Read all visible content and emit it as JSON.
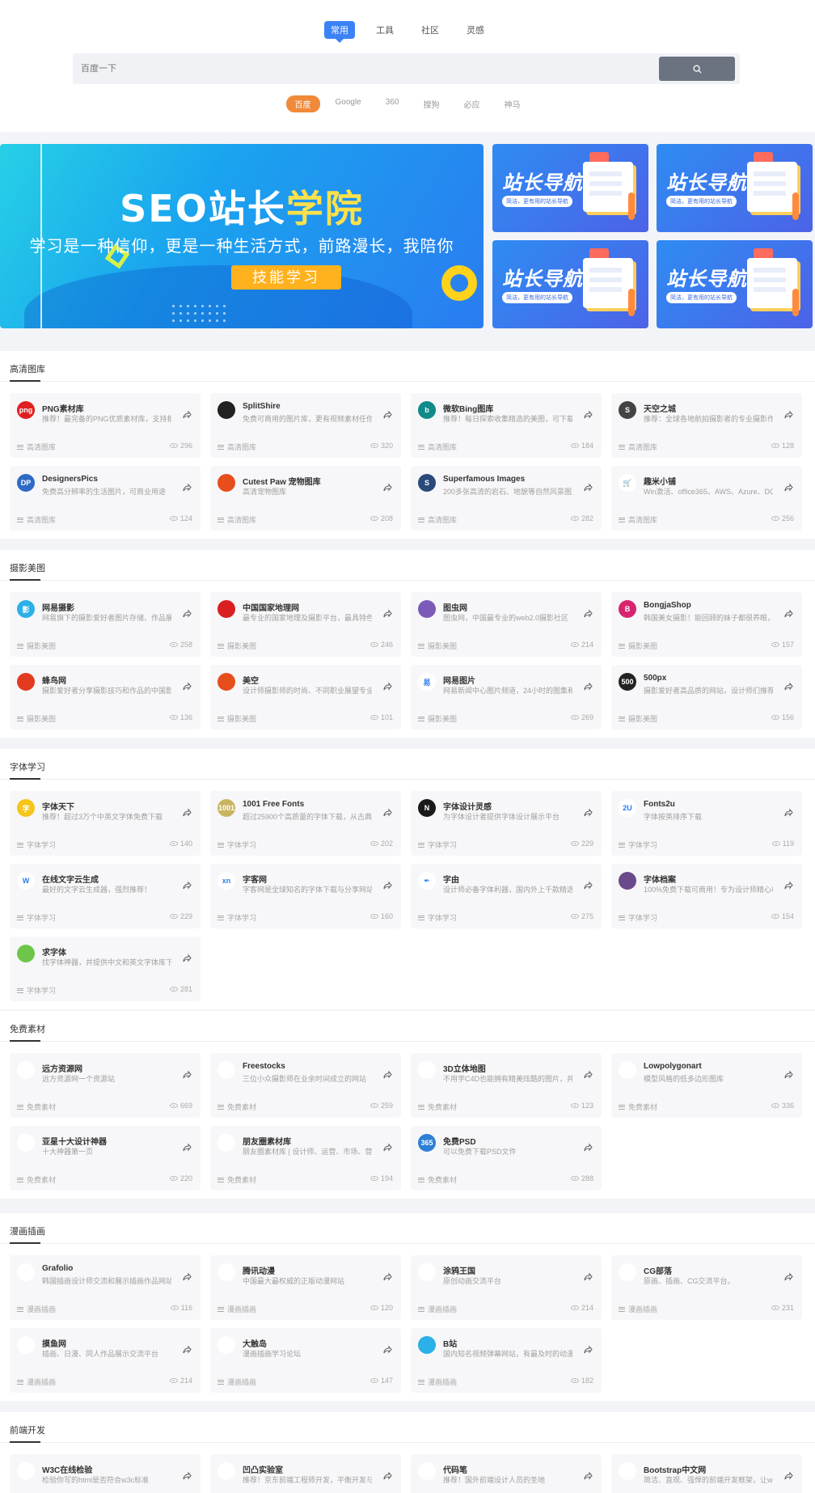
{
  "search": {
    "tabs": [
      "常用",
      "工具",
      "社区",
      "灵感"
    ],
    "active_tab": 0,
    "placeholder": "百度一下",
    "engines": [
      "百度",
      "Google",
      "360",
      "搜狗",
      "必应",
      "神马"
    ],
    "active_engine": 0
  },
  "banners": {
    "main": {
      "title_a": "SEO站长",
      "title_b": "学院",
      "subtitle": "学习是一种信仰，更是一种生活方式，前路漫长，我陪你",
      "button": "技能学习"
    },
    "small": [
      {
        "title": "站长导航",
        "pill": "简洁，更有用的站长导航"
      },
      {
        "title": "站长导航",
        "pill": "简洁，更有用的站长导航"
      },
      {
        "title": "站长导航",
        "pill": "简洁，更有用的站长导航"
      },
      {
        "title": "站长导航",
        "pill": "简洁，更有用的站长导航"
      }
    ]
  },
  "sections": [
    {
      "title": "高清图库",
      "cards": [
        {
          "name": "PNG素材库",
          "desc": "推荐！最完备的PNG优质素材库，支持批量",
          "tag": "高清图库",
          "views": "296",
          "logo": "png",
          "color": "#e02020"
        },
        {
          "name": "SplitShire",
          "desc": "免费可商用的图片库，更有视频素材任你选",
          "tag": "高清图库",
          "views": "320",
          "logo": "",
          "color": "#222"
        },
        {
          "name": "微软Bing图库",
          "desc": "推荐！每日探索收集精选的美图，可下载",
          "tag": "高清图库",
          "views": "184",
          "logo": "b",
          "color": "#108a8a"
        },
        {
          "name": "天空之城",
          "desc": "推荐：全球各地航拍摄影者的专业摄影作品",
          "tag": "高清图库",
          "views": "128",
          "logo": "S",
          "color": "#444"
        },
        {
          "name": "DesignersPics",
          "desc": "免费高分辨率的生活图片，可商业用途",
          "tag": "高清图库",
          "views": "124",
          "logo": "DP",
          "color": "#2f6bc4"
        },
        {
          "name": "Cutest Paw 宠物图库",
          "desc": "高清宠物图库",
          "tag": "高清图库",
          "views": "208",
          "logo": "",
          "color": "#e84d1c"
        },
        {
          "name": "Superfamous Images",
          "desc": "200多张高清的岩石、地貌等自然风景图片",
          "tag": "高清图库",
          "views": "282",
          "logo": "S",
          "color": "#2a4a7a"
        },
        {
          "name": "趣米小铺",
          "desc": "Win激活、office365、AWS、Azure、DO",
          "tag": "高清图库",
          "views": "256",
          "logo": "🛒",
          "color": "#ffffff"
        }
      ]
    },
    {
      "title": "摄影美图",
      "cards": [
        {
          "name": "网易摄影",
          "desc": "网易旗下的摄影爱好者图片存储、作品展示",
          "tag": "摄影美图",
          "views": "258",
          "logo": "影",
          "color": "#2bb0e8"
        },
        {
          "name": "中国国家地理网",
          "desc": "最专业的国家地理及摄影平台，最具特色的",
          "tag": "摄影美图",
          "views": "246",
          "logo": "",
          "color": "#d91f1f"
        },
        {
          "name": "图虫网",
          "desc": "图虫网，中国最专业的web2.0摄影社区",
          "tag": "摄影美图",
          "views": "214",
          "logo": "",
          "color": "#7c5bb8"
        },
        {
          "name": "BongjaShop",
          "desc": "韩国美女摄影！能回顾的妹子都很养眼，不",
          "tag": "摄影美图",
          "views": "157",
          "logo": "B",
          "color": "#d8246f"
        },
        {
          "name": "蜂鸟网",
          "desc": "摄影爱好者分享摄影技巧和作品的中国影像",
          "tag": "摄影美图",
          "views": "136",
          "logo": "",
          "color": "#e23a1e"
        },
        {
          "name": "美空",
          "desc": "设计师摄影师的时尚、不同职业展望专业摄影",
          "tag": "摄影美图",
          "views": "101",
          "logo": "",
          "color": "#e84d1c"
        },
        {
          "name": "网易图片",
          "desc": "网易新闻中心图片频道，24小时的图集和大",
          "tag": "摄影美图",
          "views": "269",
          "logo": "易",
          "color": "#ffffff"
        },
        {
          "name": "500px",
          "desc": "摄影爱好者高品质的网站，设计师们推荐套",
          "tag": "摄影美图",
          "views": "156",
          "logo": "500",
          "color": "#222"
        }
      ]
    },
    {
      "title": "字体学习",
      "cards": [
        {
          "name": "字体天下",
          "desc": "推荐！超过3万个中英文字体免费下载",
          "tag": "字体学习",
          "views": "140",
          "logo": "字",
          "color": "#f5c518"
        },
        {
          "name": "1001 Free Fonts",
          "desc": "超过25900个高质量的字体下载，从古典的",
          "tag": "字体学习",
          "views": "202",
          "logo": "1001",
          "color": "#c8b560"
        },
        {
          "name": "字体设计灵感",
          "desc": "为字体设计者提供字体设计展示平台",
          "tag": "字体学习",
          "views": "229",
          "logo": "N",
          "color": "#1a1a1a"
        },
        {
          "name": "Fonts2u",
          "desc": "字体按英排序下载",
          "tag": "字体学习",
          "views": "119",
          "logo": "2U",
          "color": "#ffffff"
        },
        {
          "name": "在线文字云生成",
          "desc": "最好的文字云生成器，强烈推荐！",
          "tag": "字体学习",
          "views": "229",
          "logo": "W",
          "color": "#ffffff"
        },
        {
          "name": "字客网",
          "desc": "字客网是全球知名的字体下载与分享网站",
          "tag": "字体学习",
          "views": "160",
          "logo": "xn",
          "color": "#ffffff"
        },
        {
          "name": "字由",
          "desc": "设计师必备字体利器，国内外上千款精选字",
          "tag": "字体学习",
          "views": "275",
          "logo": "✒",
          "color": "#ffffff"
        },
        {
          "name": "字体档案",
          "desc": "100%免费下载可商用！专为设计师精心收集",
          "tag": "字体学习",
          "views": "154",
          "logo": "",
          "color": "#6a4a8a"
        },
        {
          "name": "求字体",
          "desc": "找字体神器，并提供中文和英文字体库下载",
          "tag": "字体学习",
          "views": "281",
          "logo": "",
          "color": "#6dc64a"
        }
      ]
    },
    {
      "title": "免费素材",
      "cards": [
        {
          "name": "远方资源网",
          "desc": "远方资源网一个资源站",
          "tag": "免费素材",
          "views": "669",
          "logo": "",
          "color": "#ffffff"
        },
        {
          "name": "Freestocks",
          "desc": "三位小众摄影师在业余时间成立的网站",
          "tag": "免费素材",
          "views": "259",
          "logo": "",
          "color": "#ffffff"
        },
        {
          "name": "3D立体地图",
          "desc": "不用学C4D也能拥有精美炫酷的图片，并",
          "tag": "免费素材",
          "views": "123",
          "logo": "",
          "color": "#ffffff"
        },
        {
          "name": "Lowpolygonart",
          "desc": "模型风格的低多边形图库",
          "tag": "免费素材",
          "views": "336",
          "logo": "",
          "color": "#ffffff"
        },
        {
          "name": "亚星十大设计神器",
          "desc": "十大神器第一页",
          "tag": "免费素材",
          "views": "220",
          "logo": "",
          "color": "#ffffff"
        },
        {
          "name": "朋友圈素材库",
          "desc": "朋友圈素材库 | 设计师、运营、市场、营",
          "tag": "免费素材",
          "views": "194",
          "logo": "",
          "color": "#ffffff"
        },
        {
          "name": "免费PSD",
          "desc": "可以免费下载PSD文件",
          "tag": "免费素材",
          "views": "288",
          "logo": "365",
          "color": "#2e7fd6"
        }
      ]
    },
    {
      "title": "漫画插画",
      "cards": [
        {
          "name": "Grafolio",
          "desc": "韩国插画设计师交流和展示插画作品网站",
          "tag": "漫画插画",
          "views": "116",
          "logo": "",
          "color": "#ffffff"
        },
        {
          "name": "腾讯动漫",
          "desc": "中国最大最权威的正版动漫网站",
          "tag": "漫画插画",
          "views": "120",
          "logo": "",
          "color": "#ffffff"
        },
        {
          "name": "涂鸦王国",
          "desc": "原创动画交流平台",
          "tag": "漫画插画",
          "views": "214",
          "logo": "",
          "color": "#ffffff"
        },
        {
          "name": "CG部落",
          "desc": "原画、插画、CG交流平台。",
          "tag": "漫画插画",
          "views": "231",
          "logo": "",
          "color": "#ffffff"
        },
        {
          "name": "摸鱼网",
          "desc": "插画、日漫、同人作品展示交流平台",
          "tag": "漫画插画",
          "views": "214",
          "logo": "",
          "color": "#ffffff"
        },
        {
          "name": "大触岛",
          "desc": "漫画插画学习论坛",
          "tag": "漫画插画",
          "views": "147",
          "logo": "",
          "color": "#ffffff"
        },
        {
          "name": "B站",
          "desc": "国内知名视频弹幕网站，有最及时的动漫",
          "tag": "漫画插画",
          "views": "182",
          "logo": "",
          "color": "#2bb0e8"
        }
      ]
    },
    {
      "title": "前端开发",
      "cards": [
        {
          "name": "W3C在线检验",
          "desc": "检验你写的html是否符合w3c标准",
          "tag": "前端开发",
          "views": "",
          "logo": "",
          "color": "#ffffff"
        },
        {
          "name": "凹凸实验室",
          "desc": "推荐！京东前端工程师开发，平衡开发与",
          "tag": "前端开发",
          "views": "",
          "logo": "",
          "color": "#ffffff"
        },
        {
          "name": "代码笔",
          "desc": "推荐！国外前端设计人员的圣地",
          "tag": "前端开发",
          "views": "",
          "logo": "",
          "color": "#ffffff"
        },
        {
          "name": "Bootstrap中文网",
          "desc": "简洁、直观、强悍的前端开发框架，让web开发",
          "tag": "前端开发",
          "views": "",
          "logo": "",
          "color": "#ffffff"
        }
      ]
    }
  ]
}
